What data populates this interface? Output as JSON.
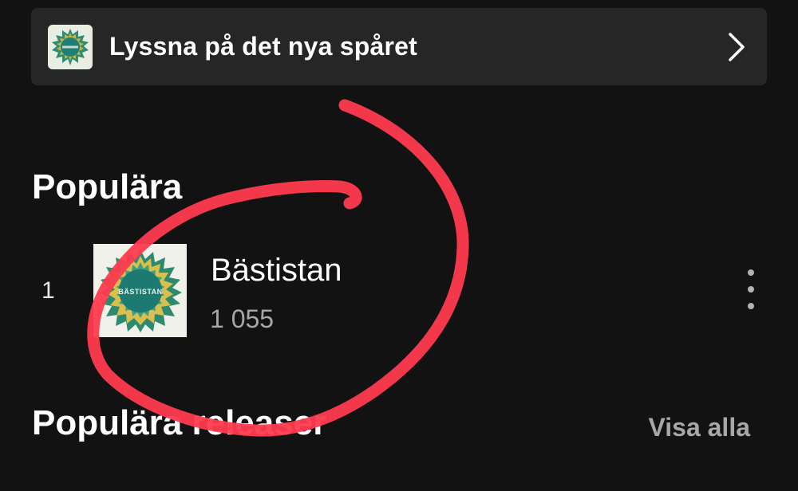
{
  "banner": {
    "label": "Lyssna på det nya spåret",
    "art_icon": "album-cover-icon",
    "chevron_icon": "chevron-right-icon"
  },
  "popular": {
    "title": "Populära",
    "tracks": [
      {
        "rank": "1",
        "title": "Bästistan",
        "plays": "1 055",
        "cover_text": "BÄSTISTAN",
        "more_icon": "more-options-icon"
      }
    ]
  },
  "releases": {
    "title": "Populära releaser",
    "see_all": "Visa alla"
  },
  "colors": {
    "background": "#121212",
    "banner": "#262626",
    "secondary_text": "#a7a7a7",
    "annotation": "#ff3b4e"
  }
}
